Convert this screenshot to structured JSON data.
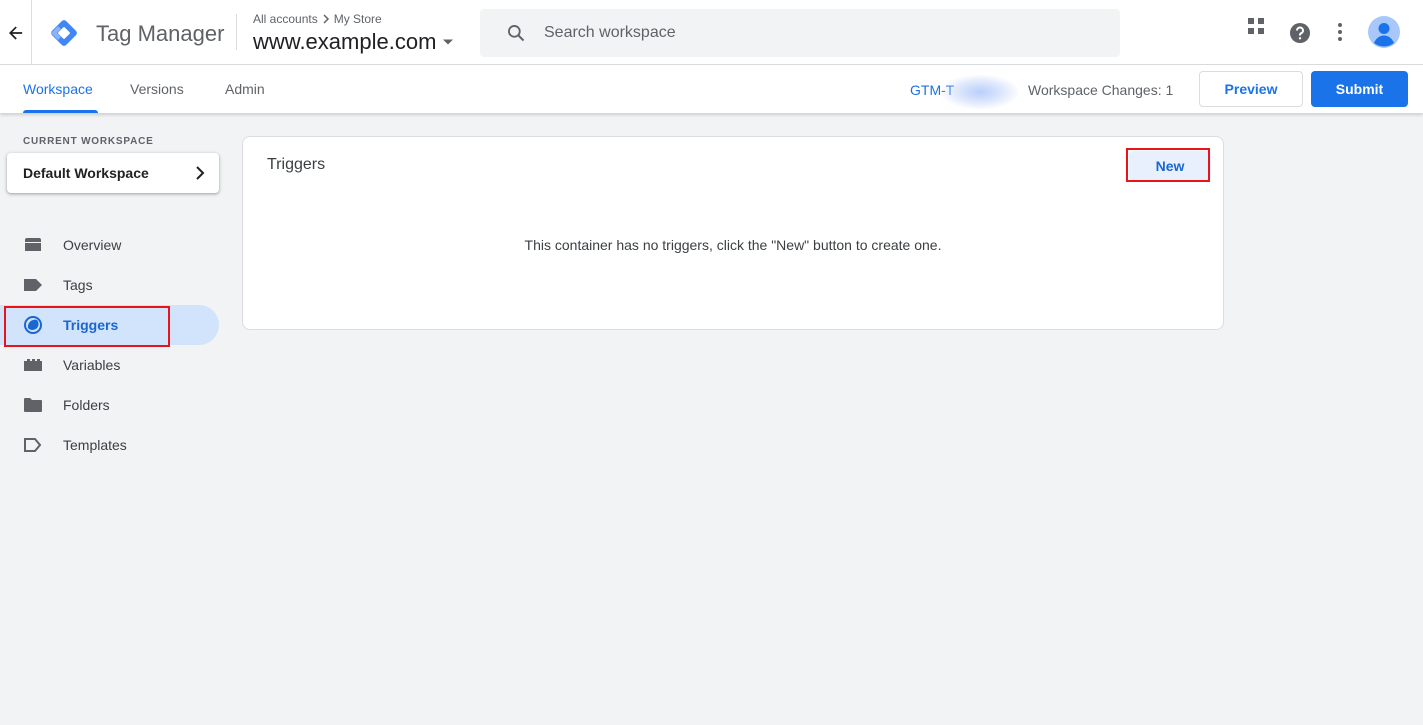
{
  "header": {
    "product_name": "Tag Manager",
    "breadcrumb": {
      "account": "All accounts",
      "sep": ">",
      "store": "My Store"
    },
    "container": "www.example.com",
    "search_placeholder": "Search workspace",
    "icons": [
      "back-arrow-icon",
      "tag-manager-logo",
      "search-icon",
      "apps-grid-icon",
      "help-icon",
      "more-vert-icon",
      "account-avatar"
    ]
  },
  "subnav": {
    "tabs": [
      {
        "label": "Workspace",
        "active": true
      },
      {
        "label": "Versions",
        "active": false
      },
      {
        "label": "Admin",
        "active": false
      }
    ],
    "container_id": "GTM-T",
    "workspace_changes": "Workspace Changes: 1",
    "preview_label": "Preview",
    "submit_label": "Submit"
  },
  "sidebar": {
    "current_workspace_label": "CURRENT WORKSPACE",
    "workspace_name": "Default Workspace",
    "items": [
      {
        "label": "Overview",
        "icon": "overview-icon"
      },
      {
        "label": "Tags",
        "icon": "tag-icon"
      },
      {
        "label": "Triggers",
        "icon": "trigger-icon",
        "active": true
      },
      {
        "label": "Variables",
        "icon": "variables-icon"
      },
      {
        "label": "Folders",
        "icon": "folder-icon"
      },
      {
        "label": "Templates",
        "icon": "template-icon"
      }
    ]
  },
  "main": {
    "title": "Triggers",
    "new_label": "New",
    "empty_message": "This container has no triggers, click the \"New\" button to create one."
  },
  "colors": {
    "accent": "#1a73e8",
    "active_nav_bg": "#d2e3fc",
    "highlight": "#e8141b",
    "background": "#f1f3f4"
  }
}
